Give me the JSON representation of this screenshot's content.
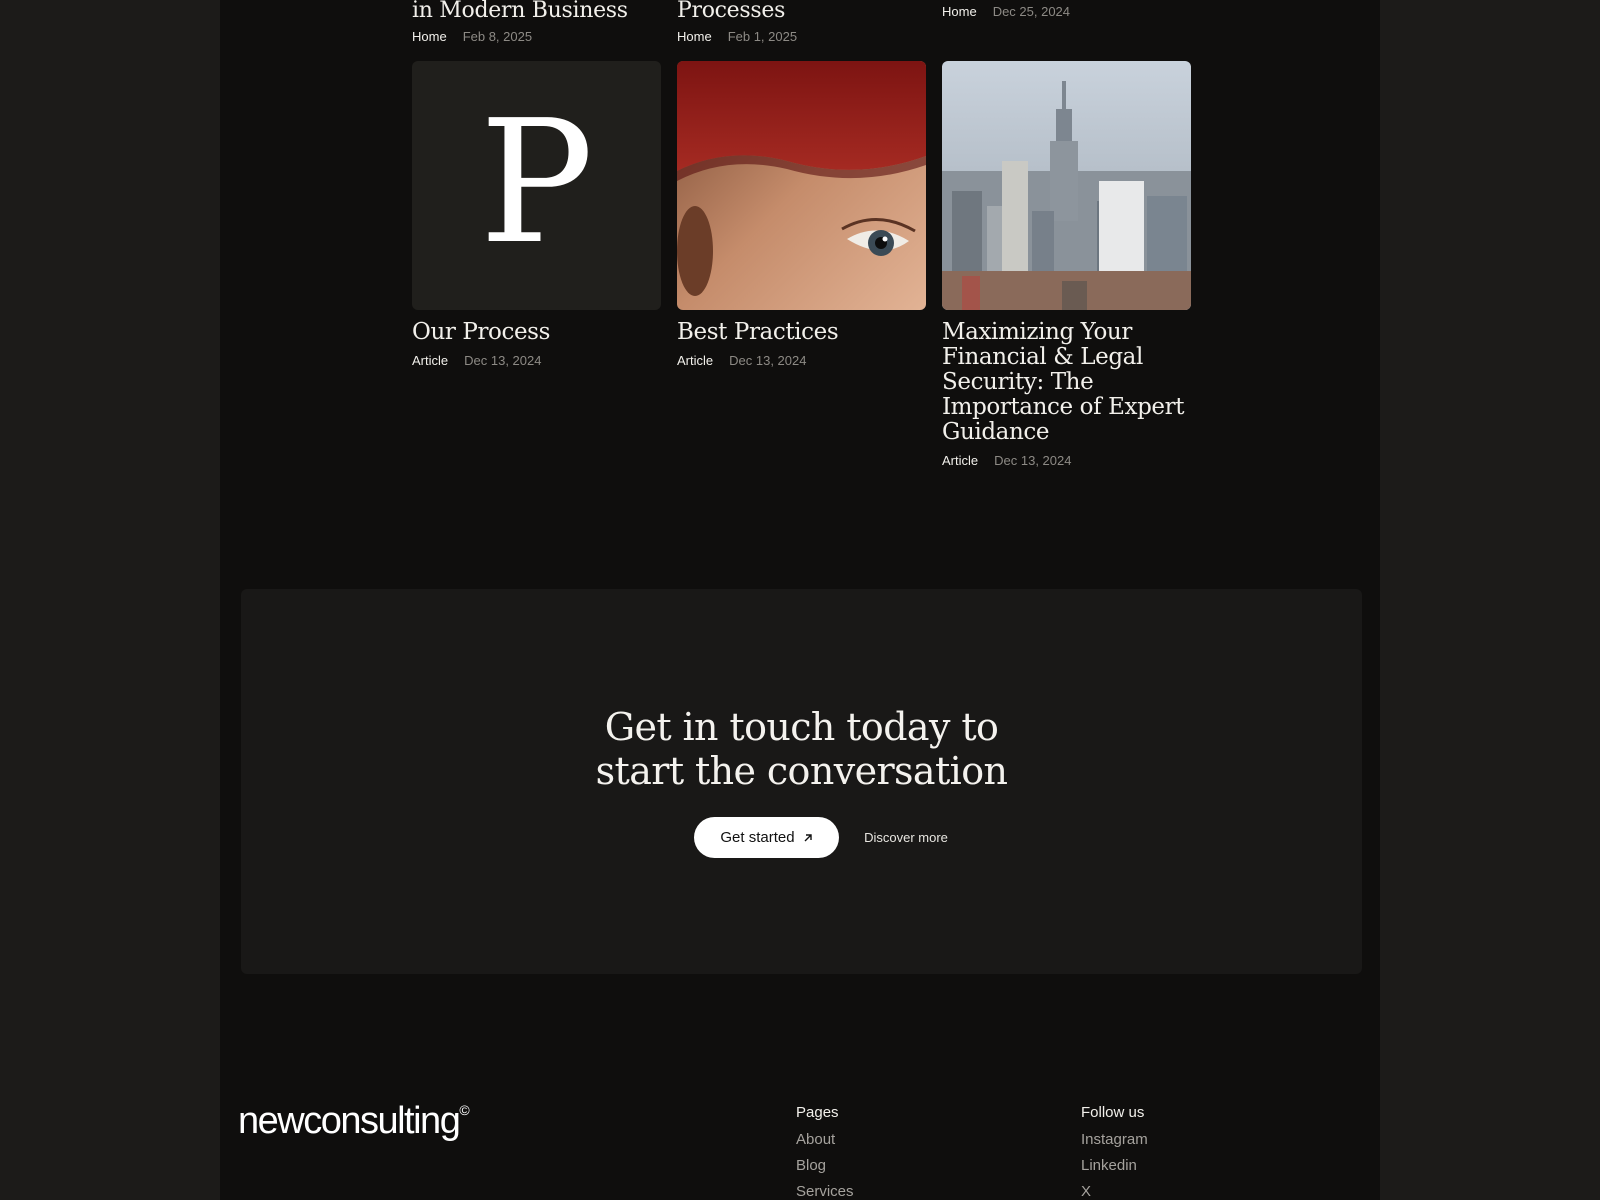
{
  "top_row": [
    {
      "title": "in Modern Business",
      "category": "Home",
      "date": "Feb 8, 2025"
    },
    {
      "title": "Processes",
      "category": "Home",
      "date": "Feb 1, 2025"
    },
    {
      "title": "",
      "category": "Home",
      "date": "Dec 25, 2024"
    }
  ],
  "cards": [
    {
      "title": "Our Process",
      "category": "Article",
      "date": "Dec 13, 2024",
      "thumb_letter": "P"
    },
    {
      "title": "Best Practices",
      "category": "Article",
      "date": "Dec 13, 2024"
    },
    {
      "title": "Maximizing Your Financial & Legal Security: The Importance of Expert Guidance",
      "category": "Article",
      "date": "Dec 13, 2024"
    }
  ],
  "cta": {
    "heading_line1": "Get in touch today to",
    "heading_line2": "start the conversation",
    "primary_label": "Get started",
    "primary_icon": "arrow-up-right-icon",
    "secondary_label": "Discover more"
  },
  "footer": {
    "logo": "newconsulting",
    "logo_mark": "©",
    "pages_heading": "Pages",
    "pages": [
      "About",
      "Blog",
      "Services"
    ],
    "follow_heading": "Follow us",
    "social": [
      "Instagram",
      "Linkedin",
      "X"
    ]
  },
  "colors": {
    "background": "#1c1b19",
    "page": "#0f0e0d",
    "cta_panel": "#191817",
    "text": "#f2f0eb",
    "muted": "#8d8a85"
  }
}
